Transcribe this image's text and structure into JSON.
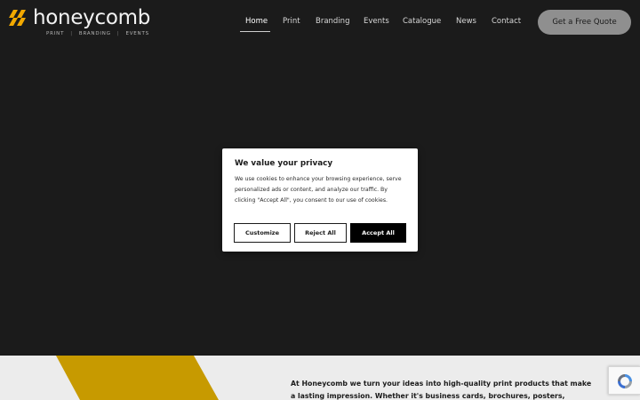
{
  "brand": {
    "name": "honeycomb",
    "tagline": [
      "PRINT",
      "BRANDING",
      "EVENTS"
    ],
    "tagline_separator": "|",
    "accent_color": "#f2a900"
  },
  "nav": {
    "items": [
      {
        "label": "Home",
        "active": true
      },
      {
        "label": "Print",
        "active": false
      },
      {
        "label": "Branding",
        "active": false
      },
      {
        "label": "Events",
        "active": false
      },
      {
        "label": "Catalogue",
        "active": false
      },
      {
        "label": "News",
        "active": false
      },
      {
        "label": "Contact",
        "active": false
      }
    ],
    "cta_label": "Get a Free Quote"
  },
  "cookie_banner": {
    "title": "We value your privacy",
    "body": "We use cookies to enhance your browsing experience, serve personalized ads or content, and analyze our traffic. By clicking \"Accept All\", you consent to our use of cookies.",
    "buttons": {
      "customize": "Customize",
      "reject": "Reject All",
      "accept": "Accept All"
    }
  },
  "intro": {
    "text": "At Honeycomb we turn your ideas into high-quality print products that make a lasting impression. Whether it's business cards, brochures, posters, packaging,"
  },
  "colors": {
    "background": "#1b1b1b",
    "section_light": "#ececec",
    "yellow": "#c79a00"
  },
  "icons": {
    "logo_mark": "honeycomb-logo-icon",
    "recaptcha": "recaptcha-icon"
  }
}
